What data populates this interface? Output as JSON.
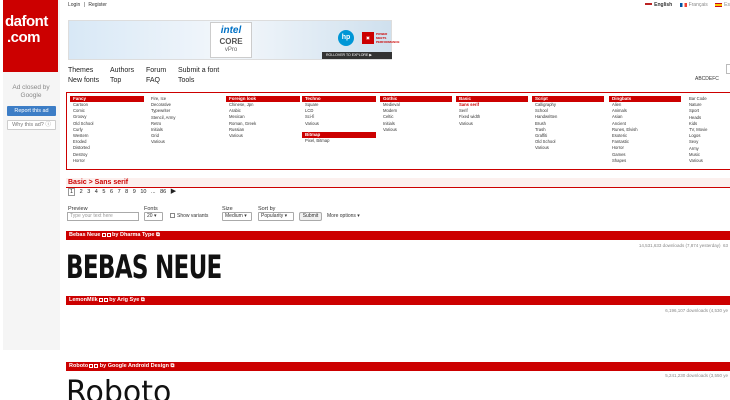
{
  "logo": {
    "line1": "dafont",
    "line2": ".com"
  },
  "ad_sidebar": {
    "adchoice": "Ad closed by Google",
    "report": "Report this ad",
    "why": "Why this ad? ⓘ"
  },
  "toplinks": {
    "login": "Login",
    "sep": "|",
    "register": "Register"
  },
  "languages": [
    {
      "label": "English",
      "selected": true
    },
    {
      "label": "Français",
      "selected": false
    },
    {
      "label": "Es",
      "selected": false
    }
  ],
  "banner": {
    "intel_brand": "intel",
    "intel_product": "CORE",
    "intel_sub": "vPro",
    "hp": "hp",
    "ad_text": "POWER MEETS PERFORMANCE",
    "rollover": "ROLLOVER TO EXPLORE ▶"
  },
  "nav": {
    "themes": "Themes",
    "authors": "Authors",
    "forum": "Forum",
    "submit": "Submit a font",
    "new": "New fonts",
    "top": "Top",
    "faq": "FAQ",
    "tools": "Tools"
  },
  "alphabet": "ABCDEFC",
  "categories": [
    {
      "head": "Fancy",
      "items": [
        "Cartoon",
        "Comic",
        "Groovy",
        "Old School",
        "Curly",
        "Western",
        "Eroded",
        "Distorted",
        "Destroy",
        "Horror"
      ]
    },
    {
      "head": "",
      "items": [
        "Fire, Ice",
        "Decorative",
        "Typewriter",
        "Stencil, Army",
        "Retro",
        "Initials",
        "Grid",
        "Various"
      ]
    },
    {
      "head": "Foreign look",
      "items": [
        "Chinese, Jpn",
        "Arabic",
        "Mexican",
        "Roman, Greek",
        "Russian",
        "Various"
      ]
    },
    {
      "head": "Techno",
      "items": [
        "Square",
        "LCD",
        "Sci-fi",
        "Various"
      ],
      "head2": "Bitmap",
      "items2": [
        "Pixel, Bitmap"
      ]
    },
    {
      "head": "Gothic",
      "items": [
        "Medieval",
        "Modern",
        "Celtic",
        "Initials",
        "Various"
      ]
    },
    {
      "head": "Basic",
      "items": [
        "Sans serif",
        "Serif",
        "Fixed width",
        "Various"
      ]
    },
    {
      "head": "Script",
      "items": [
        "Calligraphy",
        "School",
        "Handwritten",
        "Brush",
        "Trash",
        "Graffiti",
        "Old School",
        "Various"
      ]
    },
    {
      "head": "Dingbats",
      "items": [
        "Alien",
        "Animals",
        "Asian",
        "Ancient",
        "Runes, Elvish",
        "Esoteric",
        "Fantastic",
        "Horror",
        "Games",
        "Shapes"
      ]
    },
    {
      "head": "",
      "items": [
        "Bar Code",
        "Nature",
        "Sport",
        "Heads",
        "Kids",
        "TV, Movie",
        "Logos",
        "Sexy",
        "Army",
        "Music",
        "Various"
      ]
    }
  ],
  "breadcrumb": "Basic > Sans serif",
  "pagination": {
    "pages": [
      "1",
      "2",
      "3",
      "4",
      "5",
      "6",
      "7",
      "8",
      "9",
      "10"
    ],
    "ellipsis": "...",
    "last": "86",
    "next": "▶"
  },
  "filters": {
    "preview_label": "Preview",
    "preview_placeholder": "Type your text here",
    "fonts_label": "Fonts",
    "fonts_value": "20",
    "show_variants": "Show variants",
    "size_label": "Size",
    "size_value": "Medium",
    "sort_label": "Sort by",
    "sort_value": "Popularity",
    "submit": "Submit",
    "more": "More options ▾"
  },
  "fonts": [
    {
      "name": "Bebas Neue",
      "author": "by Dharma Type",
      "downloads": "14,531,633 downloads (7,874 yesterday)",
      "extra": "63",
      "preview": "BEBAS NEUE"
    },
    {
      "name": "LemonMilk",
      "author": "by Arig Sye",
      "downloads": "6,196,107 downloads (4,530 ye"
    },
    {
      "name": "Roboto",
      "author": "by Google Android Design",
      "downloads": "5,241,230 downloads (3,550 ye",
      "preview": "Roboto"
    }
  ]
}
